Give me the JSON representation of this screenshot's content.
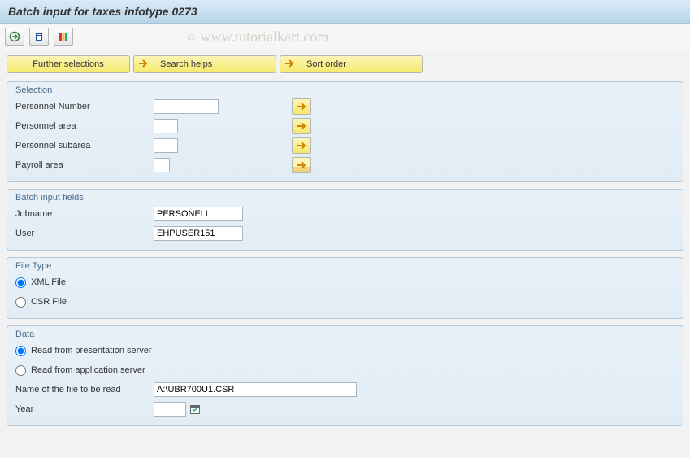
{
  "title": "Batch input for taxes infotype 0273",
  "watermark": "www.tutorialkart.com",
  "buttons": {
    "further_selections": "Further selections",
    "search_helps": "Search helps",
    "sort_order": "Sort order"
  },
  "panels": {
    "selection": {
      "title": "Selection",
      "fields": {
        "personnel_number": {
          "label": "Personnel Number",
          "value": ""
        },
        "personnel_area": {
          "label": "Personnel area",
          "value": ""
        },
        "personnel_subarea": {
          "label": "Personnel subarea",
          "value": ""
        },
        "payroll_area": {
          "label": "Payroll area",
          "value": ""
        }
      }
    },
    "batch_input": {
      "title": "Batch input fields",
      "fields": {
        "jobname": {
          "label": "Jobname",
          "value": "PERSONELL"
        },
        "user": {
          "label": "User",
          "value": "EHPUSER151"
        }
      }
    },
    "file_type": {
      "title": "File Type",
      "options": {
        "xml": "XML File",
        "csr": "CSR File"
      },
      "selected": "xml"
    },
    "data": {
      "title": "Data",
      "options": {
        "presentation": "Read from presentation server",
        "application": "Read from application server"
      },
      "selected": "presentation",
      "filename": {
        "label": "Name of the file to be read",
        "value": "A:\\UBR700U1.CSR"
      },
      "year": {
        "label": "Year",
        "value": ""
      }
    }
  }
}
